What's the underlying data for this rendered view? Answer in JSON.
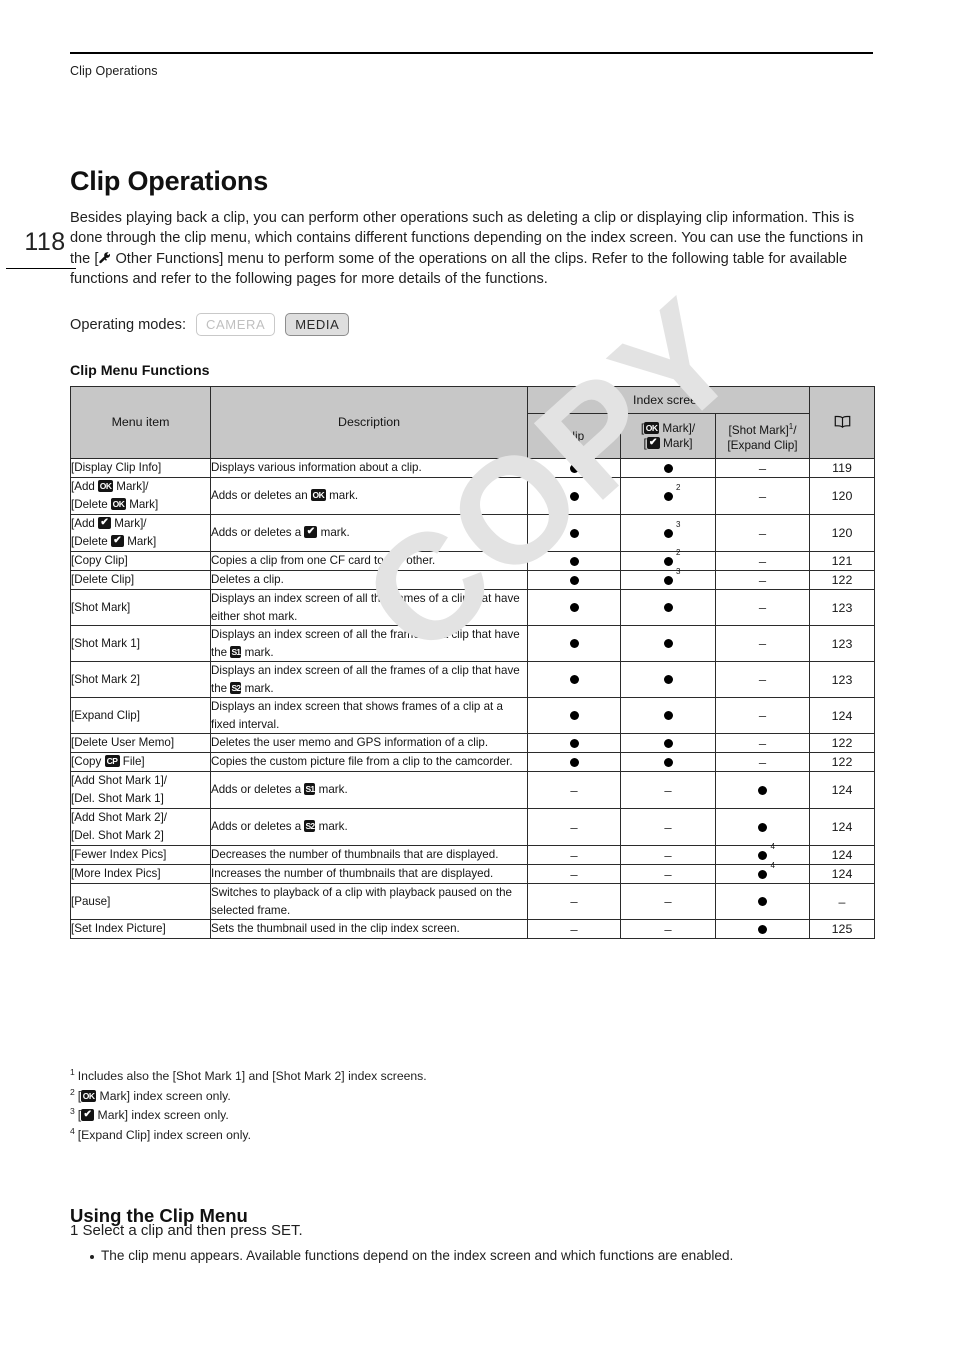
{
  "running_header": "Clip Operations",
  "page_number": "118",
  "title": "Clip Operations",
  "intro_part1": "Besides playing back a clip, you can perform other operations such as deleting a clip or displaying clip information. This is done through the clip menu, which contains different functions depending on the index screen. You can use the functions in the [",
  "intro_part2": " Other Functions] menu to perform some of the operations on all the clips. Refer to the following table for available functions and refer to the following pages for more details of the functions.",
  "operating_modes": {
    "label": "Operating modes:",
    "camera": "CAMERA",
    "media": "MEDIA"
  },
  "table_caption": "Clip Menu Functions",
  "table": {
    "headers": {
      "menu_item": "Menu item",
      "description": "Description",
      "index_screen": "Index screen",
      "clip": "Clip",
      "mark_line1_pre": "[",
      "mark_line1_post": " Mark]/",
      "mark_line2_pre": "[",
      "mark_line2_post": " Mark]",
      "shot_mark": "[Shot Mark]",
      "shot_mark_sup": "1",
      "shot_mark_slash": "/",
      "expand_clip": "[Expand Clip]",
      "book": "book-icon"
    },
    "rows": [
      {
        "menu_lines": [
          "[Display Clip Info]"
        ],
        "menu_icons": [],
        "description": "Displays various information about a clip.",
        "clip": "dot",
        "mark": "dot",
        "shot": "dash",
        "page": "119"
      },
      {
        "menu_lines": [
          "[Add ",
          " Mark]/",
          "[Delete ",
          " Mark]"
        ],
        "menu_icons": [
          "ok"
        ],
        "description": "Adds or deletes an @OK@ mark.",
        "clip": "dot",
        "mark": "dot",
        "mark_sup": "2",
        "shot": "dash",
        "page": "120"
      },
      {
        "menu_lines": [
          "[Add ",
          " Mark]/",
          "[Delete ",
          " Mark]"
        ],
        "menu_icons": [
          "check"
        ],
        "description": "Adds or deletes a @CHK@ mark.",
        "clip": "dot",
        "mark": "dot",
        "mark_sup": "3",
        "shot": "dash",
        "page": "120"
      },
      {
        "menu_lines": [
          "[Copy Clip]"
        ],
        "menu_icons": [],
        "description": "Copies a clip from one CF card to the other.",
        "clip": "dot",
        "mark": "dot",
        "mark_sup": "2",
        "shot": "dash",
        "page": "121"
      },
      {
        "menu_lines": [
          "[Delete Clip]"
        ],
        "menu_icons": [],
        "description": "Deletes a clip.",
        "clip": "dot",
        "mark": "dot",
        "mark_sup": "3",
        "shot": "dash",
        "page": "122"
      },
      {
        "menu_lines": [
          "[Shot Mark]"
        ],
        "menu_icons": [],
        "description": "Displays an index screen of all the frames of a clip that have either shot mark.",
        "clip": "dot",
        "mark": "dot",
        "shot": "dash",
        "page": "123"
      },
      {
        "menu_lines": [
          "[Shot Mark 1]"
        ],
        "menu_icons": [],
        "description": "Displays an index screen of all the frames of a clip that have the @S1@ mark.",
        "clip": "dot",
        "mark": "dot",
        "shot": "dash",
        "page": "123"
      },
      {
        "menu_lines": [
          "[Shot Mark 2]"
        ],
        "menu_icons": [],
        "description": "Displays an index screen of all the frames of a clip that have the @S2@ mark.",
        "clip": "dot",
        "mark": "dot",
        "shot": "dash",
        "page": "123"
      },
      {
        "menu_lines": [
          "[Expand Clip]"
        ],
        "menu_icons": [],
        "description": "Displays an index screen that shows frames of a clip at a fixed interval.",
        "clip": "dot",
        "mark": "dot",
        "shot": "dash",
        "page": "124"
      },
      {
        "menu_lines": [
          "[Delete User Memo]"
        ],
        "menu_icons": [],
        "description": "Deletes the user memo and GPS information of a clip.",
        "clip": "dot",
        "mark": "dot",
        "shot": "dash",
        "page": "122"
      },
      {
        "menu_lines": [
          "[Copy ",
          " File]"
        ],
        "menu_icons": [
          "cp"
        ],
        "description": "Copies the custom picture file from a clip to the camcorder.",
        "clip": "dot",
        "mark": "dot",
        "shot": "dash",
        "page": "122"
      },
      {
        "menu_lines": [
          "[Add Shot Mark 1]/",
          "[Del. Shot Mark 1]"
        ],
        "menu_icons": [],
        "description": "Adds or deletes a @S1@ mark.",
        "clip": "dash",
        "mark": "dash",
        "shot": "dot",
        "page": "124"
      },
      {
        "menu_lines": [
          "[Add Shot Mark 2]/",
          "[Del. Shot Mark 2]"
        ],
        "menu_icons": [],
        "description": "Adds or deletes a @S2@ mark.",
        "clip": "dash",
        "mark": "dash",
        "shot": "dot",
        "page": "124"
      },
      {
        "menu_lines": [
          "[Fewer Index Pics]"
        ],
        "menu_icons": [],
        "description": "Decreases the number of thumbnails that are displayed.",
        "clip": "dash",
        "mark": "dash",
        "shot": "dot",
        "shot_sup": "4",
        "page": "124"
      },
      {
        "menu_lines": [
          "[More Index Pics]"
        ],
        "menu_icons": [],
        "description": "Increases the number of thumbnails that are displayed.",
        "clip": "dash",
        "mark": "dash",
        "shot": "dot",
        "shot_sup": "4",
        "page": "124"
      },
      {
        "menu_lines": [
          "[Pause]"
        ],
        "menu_icons": [],
        "description": "Switches to playback of a clip with playback paused on the selected frame.",
        "clip": "dash",
        "mark": "dash",
        "shot": "dot",
        "page": "–"
      },
      {
        "menu_lines": [
          "[Set Index Picture]"
        ],
        "menu_icons": [],
        "description": "Sets the thumbnail used in the clip index screen.",
        "clip": "dash",
        "mark": "dash",
        "shot": "dot",
        "page": "125"
      }
    ]
  },
  "footnotes": [
    {
      "num": "1",
      "text": "Includes also the [Shot Mark 1] and [Shot Mark 2] index screens.",
      "icon": null
    },
    {
      "num": "2",
      "pre": "[",
      "post": " Mark] index screen only.",
      "icon": "ok"
    },
    {
      "num": "3",
      "pre": "[",
      "post": " Mark] index screen only.",
      "icon": "check"
    },
    {
      "num": "4",
      "text": "[Expand Clip] index screen only.",
      "icon": null
    }
  ],
  "subheading": "Using the Clip Menu",
  "step1": "1 Select a clip and then press SET.",
  "step1_bullet": "The clip menu appears. Available functions depend on the index screen and which functions are enabled.",
  "watermark": "COPY",
  "colors": {
    "header_bg": "#c7c7c7",
    "border": "#2b2b2b",
    "watermark": "#e3e3e3",
    "mode_on_bg": "#dedede"
  }
}
